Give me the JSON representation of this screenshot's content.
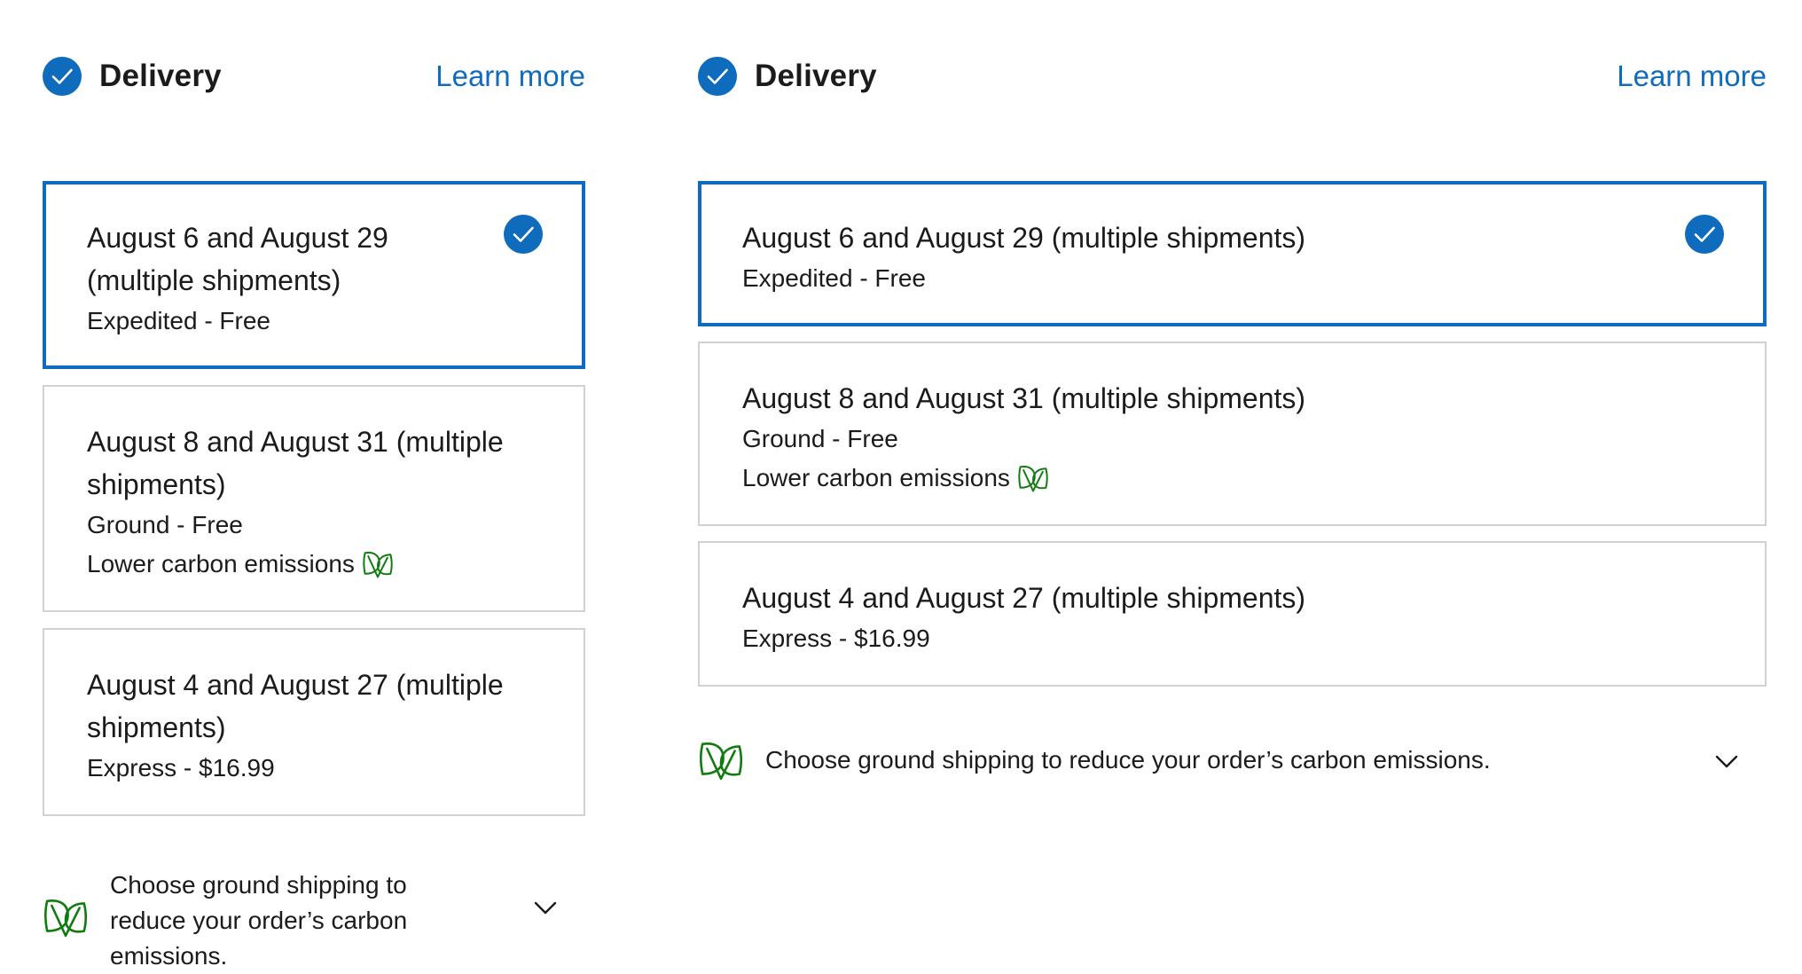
{
  "accent_color": "#0f6cbd",
  "eco_color": "#107c10",
  "icons": {
    "header": "checkmark-circle-icon",
    "selected": "checkmark-circle-icon",
    "eco": "leaf-icon",
    "expand": "chevron-down-icon"
  },
  "panels": [
    {
      "header": {
        "title": "Delivery",
        "learn_more": "Learn more"
      },
      "options": [
        {
          "date_lines": [
            "August 6 and August 29",
            "(multiple shipments)"
          ],
          "method": "Expedited - Free",
          "selected": true
        },
        {
          "date_lines": [
            "August 8 and August 31 (multiple",
            "shipments)"
          ],
          "method": "Ground - Free",
          "eco_label": "Lower carbon emissions",
          "selected": false
        },
        {
          "date_lines": [
            "August 4 and August 27 (multiple",
            "shipments)"
          ],
          "method": "Express - $16.99",
          "selected": false
        }
      ],
      "tip": {
        "lines": [
          "Choose ground shipping to",
          "reduce your order’s carbon",
          "emissions."
        ]
      }
    },
    {
      "header": {
        "title": "Delivery",
        "learn_more": "Learn more"
      },
      "options": [
        {
          "date_lines": [
            "August 6 and August 29 (multiple shipments)"
          ],
          "method": "Expedited - Free",
          "selected": true
        },
        {
          "date_lines": [
            "August 8 and August 31 (multiple shipments)"
          ],
          "method": "Ground - Free",
          "eco_label": "Lower carbon emissions",
          "selected": false
        },
        {
          "date_lines": [
            "August 4 and August 27 (multiple shipments)"
          ],
          "method": "Express - $16.99",
          "selected": false
        }
      ],
      "tip": {
        "lines": [
          "Choose ground shipping to reduce your order’s carbon emissions."
        ]
      }
    }
  ]
}
